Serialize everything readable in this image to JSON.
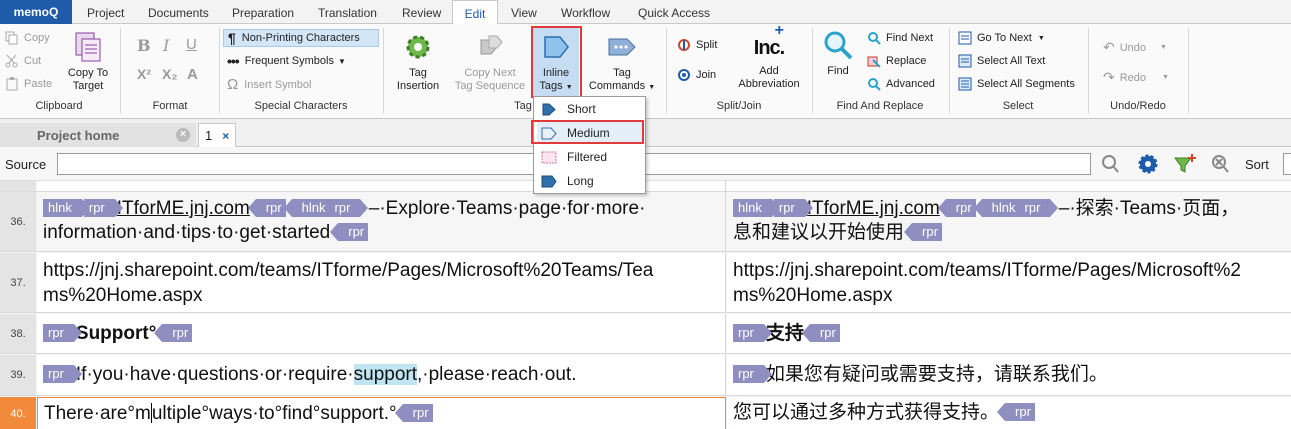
{
  "app": {
    "name": "memoQ"
  },
  "menu": {
    "tabs": [
      "Project",
      "Documents",
      "Preparation",
      "Translation",
      "Review",
      "Edit",
      "View",
      "Workflow",
      "Quick Access"
    ],
    "active": "Edit"
  },
  "ribbon": {
    "clipboard": {
      "label": "Clipboard",
      "copy": "Copy",
      "cut": "Cut",
      "paste": "Paste",
      "copy_to_target": "Copy To",
      "copy_to_target2": "Target"
    },
    "format": {
      "label": "Format"
    },
    "special": {
      "label": "Special Characters",
      "non_printing": "Non-Printing Characters",
      "frequent_symbols": "Frequent Symbols",
      "insert_symbol": "Insert Symbol"
    },
    "tags": {
      "label": "Tag",
      "tag_insertion": "Tag",
      "tag_insertion2": "Insertion",
      "copy_next": "Copy Next",
      "copy_next2": "Tag Sequence",
      "inline_tags": "Inline",
      "inline_tags2": "Tags",
      "tag_commands": "Tag",
      "tag_commands2": "Commands"
    },
    "split_join": {
      "label": "Split/Join",
      "split": "Split",
      "join": "Join",
      "add_abbr": "Add",
      "add_abbr2": "Abbreviation",
      "inc_icon": "Inc."
    },
    "find_replace": {
      "label": "Find And Replace",
      "find": "Find",
      "find_next": "Find Next",
      "replace": "Replace",
      "advanced": "Advanced"
    },
    "select": {
      "label": "Select",
      "go_to_next": "Go To Next",
      "select_all_text": "Select All Text",
      "select_all_segments": "Select All Segments"
    },
    "undo_redo": {
      "label": "Undo/Redo",
      "undo": "Undo",
      "redo": "Redo"
    }
  },
  "inline_tags_menu": {
    "items": [
      "Short",
      "Medium",
      "Filtered",
      "Long"
    ],
    "selected": "Medium"
  },
  "doc_tabs": {
    "project_home": "Project home",
    "doc1": "1"
  },
  "source_bar": {
    "label": "Source",
    "value": "",
    "sort": "Sort"
  },
  "colors": {
    "accent": "#1e5ba8",
    "tag": "#8e8ec0",
    "highlight": "#e03a3a",
    "active_row": "#f28a3c"
  },
  "rows": [
    {
      "num": "36.",
      "src_link": "ITforME.jnj.com",
      "src_text1": "·–·Explore·Teams·page·for·more·",
      "src_text2": "information·and·tips·to·get·started",
      "tgt_link": "ITforME.jnj.com",
      "tgt_text1": "·–·探索·Teams·页面，",
      "tgt_text2": "息和建议以开始使用"
    },
    {
      "num": "37.",
      "src1": "https://jnj.sharepoint.com/teams/ITforme/Pages/Microsoft%20Teams/Tea",
      "src2": "ms%20Home.aspx",
      "tgt1": "https://jnj.sharepoint.com/teams/ITforme/Pages/Microsoft%2",
      "tgt2": "ms%20Home.aspx"
    },
    {
      "num": "38.",
      "src": "Support°",
      "tgt": "支持"
    },
    {
      "num": "39.",
      "src_a": "If·you·have·questions·or·require·",
      "src_hl": "support",
      "src_b": ",·please·reach·out.",
      "tgt": "如果您有疑问或需要支持，请联系我们。"
    },
    {
      "num": "40.",
      "src_a": "There·are°m",
      "src_b": "ultiple°ways·to°find°support.°",
      "tgt": "您可以通过多种方式获得支持。"
    }
  ],
  "tag_labels": {
    "hlnk": "hlnk",
    "rpr": "rpr"
  }
}
